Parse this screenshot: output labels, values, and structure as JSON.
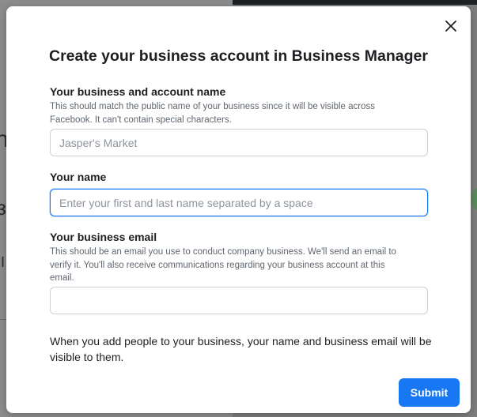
{
  "modal": {
    "title": "Create your business account in Business Manager",
    "business_name": {
      "label": "Your business and account name",
      "help": "This should match the public name of your business since it will be visible across Facebook. It can't contain special characters.",
      "placeholder": "Jasper's Market",
      "value": ""
    },
    "your_name": {
      "label": "Your name",
      "placeholder": "Enter your first and last name separated by a space",
      "value": ""
    },
    "business_email": {
      "label": "Your business email",
      "help": "This should be an email you use to conduct company business. We'll send an email to verify it. You'll also receive communications regarding your business account at this email.",
      "placeholder": "",
      "value": ""
    },
    "notice": "When you add people to your business, your name and business email will be visible to them.",
    "submit_label": "Submit"
  },
  "icons": {
    "close": "close-icon"
  },
  "colors": {
    "accent": "#1877f2",
    "title_text": "#1c1e21",
    "help_text": "#606770",
    "input_border": "#ccd0d5",
    "dimmed_backdrop": "#8c8c8c"
  }
}
